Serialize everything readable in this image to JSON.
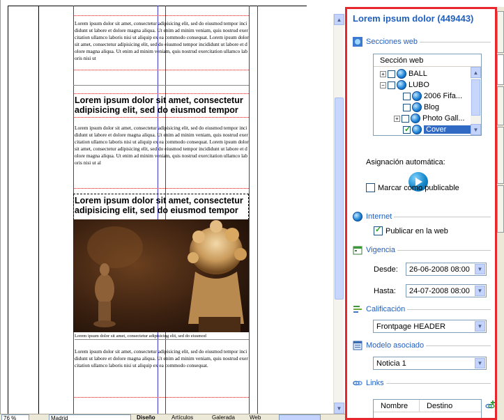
{
  "editor": {
    "lorem_block_1": "Lorem ipsum dolor sit amet, consectetur adipisicing elit, sed do eiusmod tempor incididunt ut labore et dolore magna aliqua. Ut enim ad minim veniam, quis nostrud exercitation ullamco laboris nisi ut aliquip ex ea commodo consequat. Lorem ipsum dolor sit amet, consectetur adipisicing elit, sed do eiusmod tempor incididunt ut labore et dolore magna aliqua. Ut enim ad minim veniam, quis nostrud exercitation ullamco laboris nisi ut",
    "heading_1": "Lorem ipsum dolor sit amet, consectetur adipisicing elit, sed do eiusmod tempor",
    "lorem_block_2": "Lorem ipsum dolor sit amet, consectetur adipisicing elit, sed do eiusmod tempor incididunt ut labore et dolore magna aliqua. Ut enim ad minim veniam, quis nostrud exercitation ullamco laboris nisi ut aliquip ex ea commodo consequat. Lorem ipsum dolor sit amet, consectetur adipisicing elit, sed do eiusmod tempor incididunt ut labore et dolore magna aliqua. Ut enim ad minim veniam, quis nostrud exercitation ullamco laboris nisi ut al",
    "heading_2": "Lorem ipsum dolor sit amet, consectetur adipisicing elit, sed do eiusmod tempor",
    "caption": "Lorem ipsum dolor sit amet, consectetur adipisicing elit, sed do eiusmod",
    "lorem_block_3": "Lorem ipsum dolor sit amet, consectetur adipisicing elit, sed do eiusmod tempor incididunt ut labore et dolore magna aliqua. Ut enim ad minim veniam, quis nostrud exercitation ullamco laboris nisi ut aliquip ex ea commodo consequat."
  },
  "statusbar": {
    "zoom": "76 %",
    "location": "Madrid",
    "tabs": [
      "Diseño",
      "Artículos",
      "Galerada",
      "Web"
    ],
    "active_tab": "Diseño"
  },
  "panel": {
    "title": "Lorem ipsum dolor (449443)",
    "secciones_label": "Secciones web",
    "tree_header": "Sección web",
    "tree_items": [
      {
        "label": "BALL",
        "checked": false
      },
      {
        "label": "LUBO",
        "checked": false
      },
      {
        "label": "2006 Fifa...",
        "checked": false
      },
      {
        "label": "Blog",
        "checked": false
      },
      {
        "label": "Photo Gall...",
        "checked": false
      },
      {
        "label": "Cover",
        "checked": true
      }
    ],
    "asignacion_label": "Asignación automática:",
    "marcar_label": "Marcar como publicable",
    "internet_label": "Internet",
    "publicar_label": "Publicar en la web",
    "vigencia_label": "Vigencia",
    "desde_label": "Desde:",
    "desde_value": "26-06-2008 08:00",
    "hasta_label": "Hasta:",
    "hasta_value": "24-07-2008 08:00",
    "calificacion_label": "Calificación",
    "calificacion_value": "Frontpage HEADER",
    "modelo_label": "Modelo asociado",
    "modelo_value": "Noticia 1",
    "links_label": "Links",
    "links_col_nombre": "Nombre",
    "links_col_destino": "Destino"
  },
  "colors": {
    "accent": "#1f5fbf",
    "highlight_border": "#e8262d",
    "selection": "#316ac5"
  }
}
